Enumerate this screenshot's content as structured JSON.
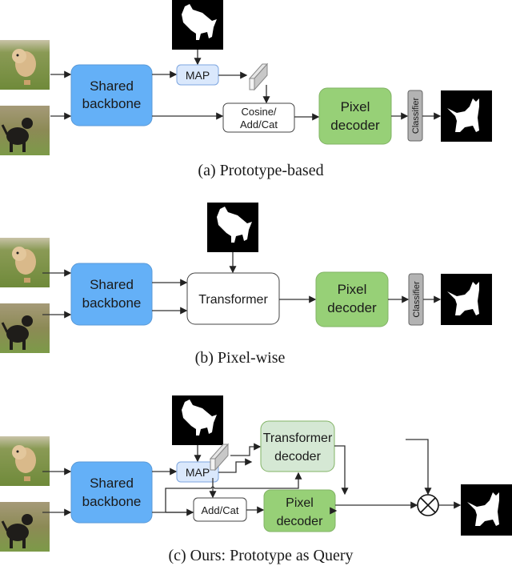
{
  "panels": {
    "a": {
      "caption": "(a) Prototype-based",
      "backbone": [
        "Shared",
        "backbone"
      ],
      "map": "MAP",
      "fuse": [
        "Cosine/",
        "Add/Cat"
      ],
      "decoder": [
        "Pixel",
        "decoder"
      ],
      "classifier": "Classifier"
    },
    "b": {
      "caption": "(b) Pixel-wise",
      "backbone": [
        "Shared",
        "backbone"
      ],
      "transformer": "Transformer",
      "decoder": [
        "Pixel",
        "decoder"
      ],
      "classifier": "Classifier"
    },
    "c": {
      "caption": "(c) Ours: Prototype as Query",
      "backbone": [
        "Shared",
        "backbone"
      ],
      "map": "MAP",
      "tdecoder": [
        "Transformer",
        "decoder"
      ],
      "fuse": "Add/Cat",
      "decoder": [
        "Pixel",
        "decoder"
      ],
      "multiply_symbol": "⊗"
    }
  },
  "colors": {
    "backbone": "#64b0f7",
    "map": "#dae8fc",
    "pixel_decoder": "#97d077",
    "transformer_decoder": "#d5e8d4",
    "classifier": "#b3b3b3"
  }
}
